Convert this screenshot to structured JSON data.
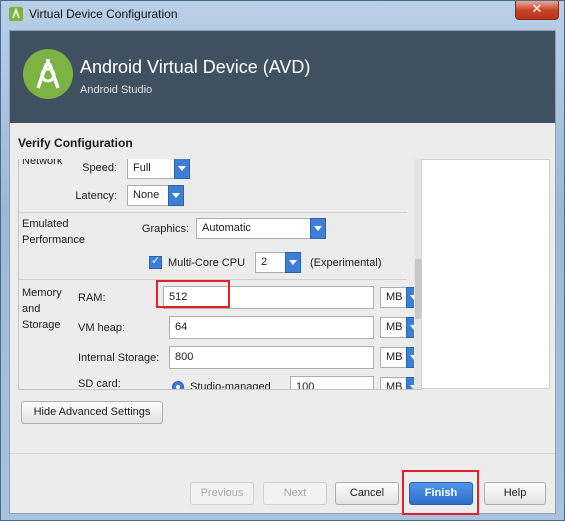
{
  "window": {
    "title": "Virtual Device Configuration"
  },
  "header": {
    "title": "Android Virtual Device (AVD)",
    "subtitle": "Android Studio"
  },
  "section_title": "Verify Configuration",
  "network": {
    "group_label": "Network",
    "speed_label": "Speed:",
    "speed_value": "Full",
    "latency_label": "Latency:",
    "latency_value": "None"
  },
  "emulated_performance": {
    "group_label_line1": "Emulated",
    "group_label_line2": "Performance",
    "graphics_label": "Graphics:",
    "graphics_value": "Automatic",
    "multicore_label": "Multi-Core CPU",
    "multicore_checked": true,
    "cores_value": "2",
    "experimental_label": "(Experimental)"
  },
  "memory_storage": {
    "group_label_line1": "Memory",
    "group_label_line2": "and",
    "group_label_line3": "Storage",
    "ram_label": "RAM:",
    "ram_value": "512",
    "ram_unit": "MB",
    "vmheap_label": "VM heap:",
    "vmheap_value": "64",
    "vmheap_unit": "MB",
    "internal_label": "Internal Storage:",
    "internal_value": "800",
    "internal_unit": "MB",
    "sdcard_label": "SD card:",
    "sdcard_option": "Studio-managed",
    "sdcard_value": "100",
    "sdcard_unit": "MB"
  },
  "advanced_button": "Hide Advanced Settings",
  "footer": {
    "previous": "Previous",
    "next": "Next",
    "cancel": "Cancel",
    "finish": "Finish",
    "help": "Help"
  },
  "colors": {
    "header_bg": "#3f5161",
    "accent": "#3d7fd6",
    "highlight": "#e0202a"
  }
}
